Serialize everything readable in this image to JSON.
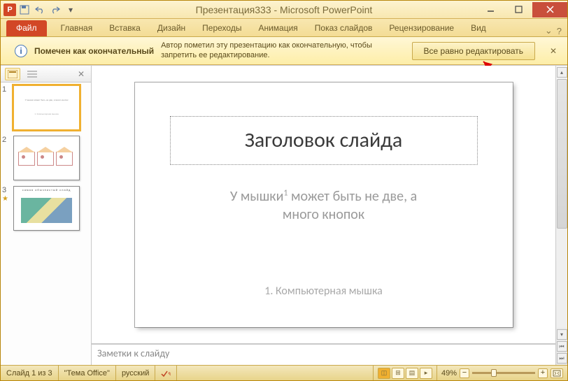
{
  "titlebar": {
    "title_doc": "Презентация333",
    "title_app": "Microsoft PowerPoint",
    "title_combined": "Презентация333 - Microsoft PowerPoint"
  },
  "ribbon": {
    "file": "Файл",
    "tabs": [
      "Главная",
      "Вставка",
      "Дизайн",
      "Переходы",
      "Анимация",
      "Показ слайдов",
      "Рецензирование",
      "Вид"
    ]
  },
  "infobar": {
    "title": "Помечен как окончательный",
    "text": "Автор пометил эту презентацию как окончательную, чтобы запретить ее редактирование.",
    "button": "Все равно редактировать"
  },
  "annotation": {
    "label": "1"
  },
  "thumbnails": {
    "items": [
      {
        "num": "1",
        "selected": true,
        "hasAnim": false
      },
      {
        "num": "2",
        "selected": false,
        "hasAnim": false
      },
      {
        "num": "3",
        "selected": false,
        "hasAnim": true
      }
    ]
  },
  "slide": {
    "title": "Заголовок слайда",
    "subtitle_line1": "У мышки",
    "subtitle_sup": "1",
    "subtitle_line1b": " может быть не две, а",
    "subtitle_line2": "много кнопок",
    "footnote": "1. Компьютерная мышка"
  },
  "notes": {
    "placeholder": "Заметки к слайду"
  },
  "statusbar": {
    "slide_info": "Слайд 1 из 3",
    "theme": "\"Тема Office\"",
    "language": "русский",
    "zoom": "49%"
  }
}
